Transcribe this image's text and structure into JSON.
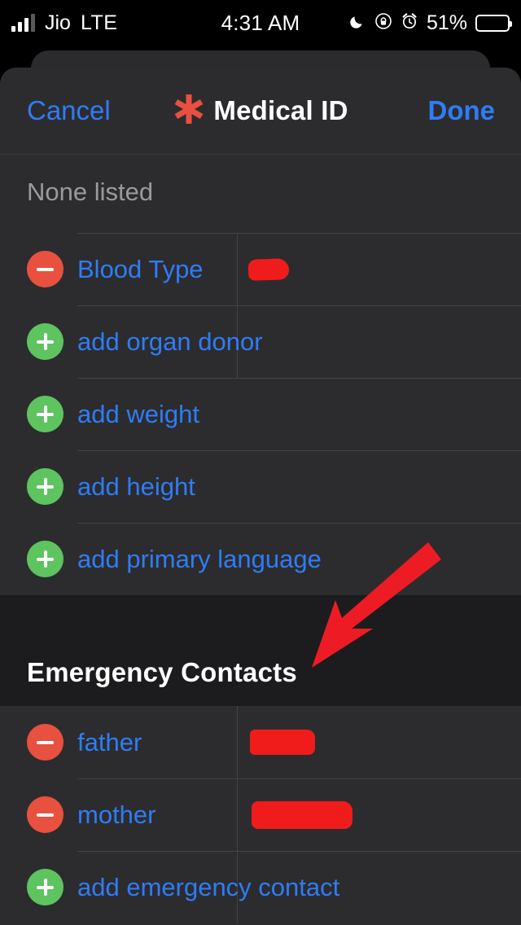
{
  "status_bar": {
    "carrier": "Jio",
    "network": "LTE",
    "time": "4:31 AM",
    "battery_percent": "51%",
    "battery_level": 51,
    "icons": [
      "signal-bars-icon",
      "moon-icon",
      "rotation-lock-icon",
      "alarm-clock-icon",
      "battery-icon"
    ]
  },
  "nav_bar": {
    "cancel_label": "Cancel",
    "title": "Medical ID",
    "done_label": "Done",
    "title_icon": "medical-id-star-icon"
  },
  "medical_info": {
    "none_listed_text": "None listed",
    "rows": [
      {
        "action": "remove",
        "label": "Blood Type",
        "value": "[redacted]",
        "redacted": true,
        "blob": "blob-a",
        "has_value_column": true
      },
      {
        "action": "add",
        "label": "add organ donor",
        "value": "",
        "redacted": false,
        "blob": "",
        "has_value_column": true
      },
      {
        "action": "add",
        "label": "add weight",
        "value": "",
        "redacted": false,
        "blob": "",
        "has_value_column": false
      },
      {
        "action": "add",
        "label": "add height",
        "value": "",
        "redacted": false,
        "blob": "",
        "has_value_column": false
      },
      {
        "action": "add",
        "label": "add primary language",
        "value": "",
        "redacted": false,
        "blob": "",
        "has_value_column": false
      }
    ]
  },
  "emergency_contacts": {
    "section_title": "Emergency Contacts",
    "rows": [
      {
        "action": "remove",
        "label": "father",
        "value": "[redacted]",
        "redacted": true,
        "blob": "blob-b",
        "has_value_column": true
      },
      {
        "action": "remove",
        "label": "mother",
        "value": "[redacted]",
        "redacted": true,
        "blob": "blob-c",
        "has_value_column": true
      },
      {
        "action": "add",
        "label": "add emergency contact",
        "value": "",
        "redacted": false,
        "blob": "",
        "has_value_column": true
      }
    ]
  },
  "annotation": {
    "type": "arrow",
    "color": "#ed1c24",
    "points_to": "Emergency Contacts"
  },
  "colors": {
    "accent_blue": "#2f7cf6",
    "remove_red": "#e8503f",
    "add_green": "#5dc45f",
    "medical_star_red": "#e8503f",
    "card_background": "#2c2c2e",
    "section_background": "#1c1c1e",
    "separator": "#434345",
    "secondary_text": "#9a9a9e",
    "annotation_red": "#ed1c24"
  }
}
